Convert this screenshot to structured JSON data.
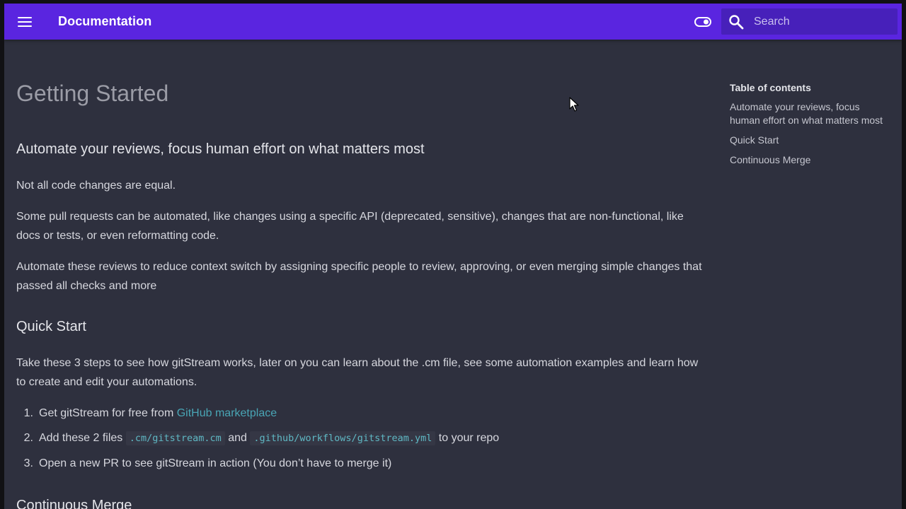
{
  "header": {
    "menu_icon": "hamburger-menu-icon",
    "title": "Documentation",
    "toggle_icon": "toggle-switch-icon",
    "search": {
      "icon": "search-icon",
      "placeholder": "Search"
    },
    "background_color": "#5a25e0"
  },
  "main": {
    "page_title": "Getting Started",
    "sections": [
      {
        "heading": "Automate your reviews, focus human effort on what matters most",
        "paragraphs": [
          "Not all code changes are equal.",
          "Some pull requests can be automated, like changes using a specific API (deprecated, sensitive), changes that are non-functional, like docs or tests, or even reformatting code.",
          "Automate these reviews to reduce context switch by assigning specific people to review, approving, or even merging simple changes that passed all checks and more"
        ]
      },
      {
        "heading": "Quick Start",
        "paragraphs": [
          "Take these 3 steps to see how gitStream works, later on you can learn about the .cm file, see some automation examples and learn how to create and edit your automations."
        ],
        "steps": [
          {
            "number": "1.",
            "text": "Get gitStream for free from ",
            "link": "GitHub marketplace"
          },
          {
            "number": "2.",
            "text_before": "Add these 2 files ",
            "code1": ".cm/gitstream.cm",
            "text_middle": " and ",
            "code2": ".github/workflows/gitstream.yml",
            "text_after": " to your repo"
          },
          {
            "number": "3.",
            "text": "Open a new PR to see gitStream in action (You don’t have to merge it)"
          }
        ]
      },
      {
        "heading": "Continuous Merge"
      }
    ]
  },
  "toc": {
    "title": "Table of contents",
    "items": [
      "Automate your reviews, focus human effort on what matters most",
      "Quick Start",
      "Continuous Merge"
    ]
  },
  "colors": {
    "page_background": "#2e303e",
    "link": "#49a5b5",
    "code_text": "#5fb8c4"
  }
}
